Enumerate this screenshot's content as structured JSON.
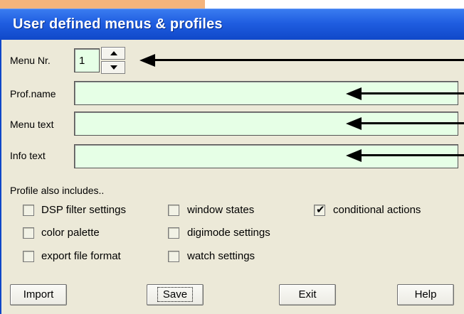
{
  "window": {
    "title": "User defined menus & profiles"
  },
  "menu_nr": {
    "label": "Menu Nr.",
    "value": "1"
  },
  "fields": [
    {
      "label": "Prof.name",
      "value": ""
    },
    {
      "label": "Menu text",
      "value": ""
    },
    {
      "label": "Info text",
      "value": ""
    }
  ],
  "profile_section": {
    "heading": "Profile also  includes.."
  },
  "checkboxes": [
    {
      "label": "DSP filter settings",
      "checked": false
    },
    {
      "label": "window states",
      "checked": false
    },
    {
      "label": "conditional actions",
      "checked": true
    },
    {
      "label": "color palette",
      "checked": false
    },
    {
      "label": "digimode settings",
      "checked": false
    },
    {
      "label": "export file format",
      "checked": false
    },
    {
      "label": "watch settings",
      "checked": false
    }
  ],
  "buttons": {
    "import": "Import",
    "save": "Save",
    "exit": "Exit",
    "help": "Help"
  },
  "colors": {
    "titlebar": "#1f5de0",
    "client_bg": "#ece9d8",
    "field_bg": "#e6ffe6",
    "corner_strip": "#f4b47c"
  }
}
